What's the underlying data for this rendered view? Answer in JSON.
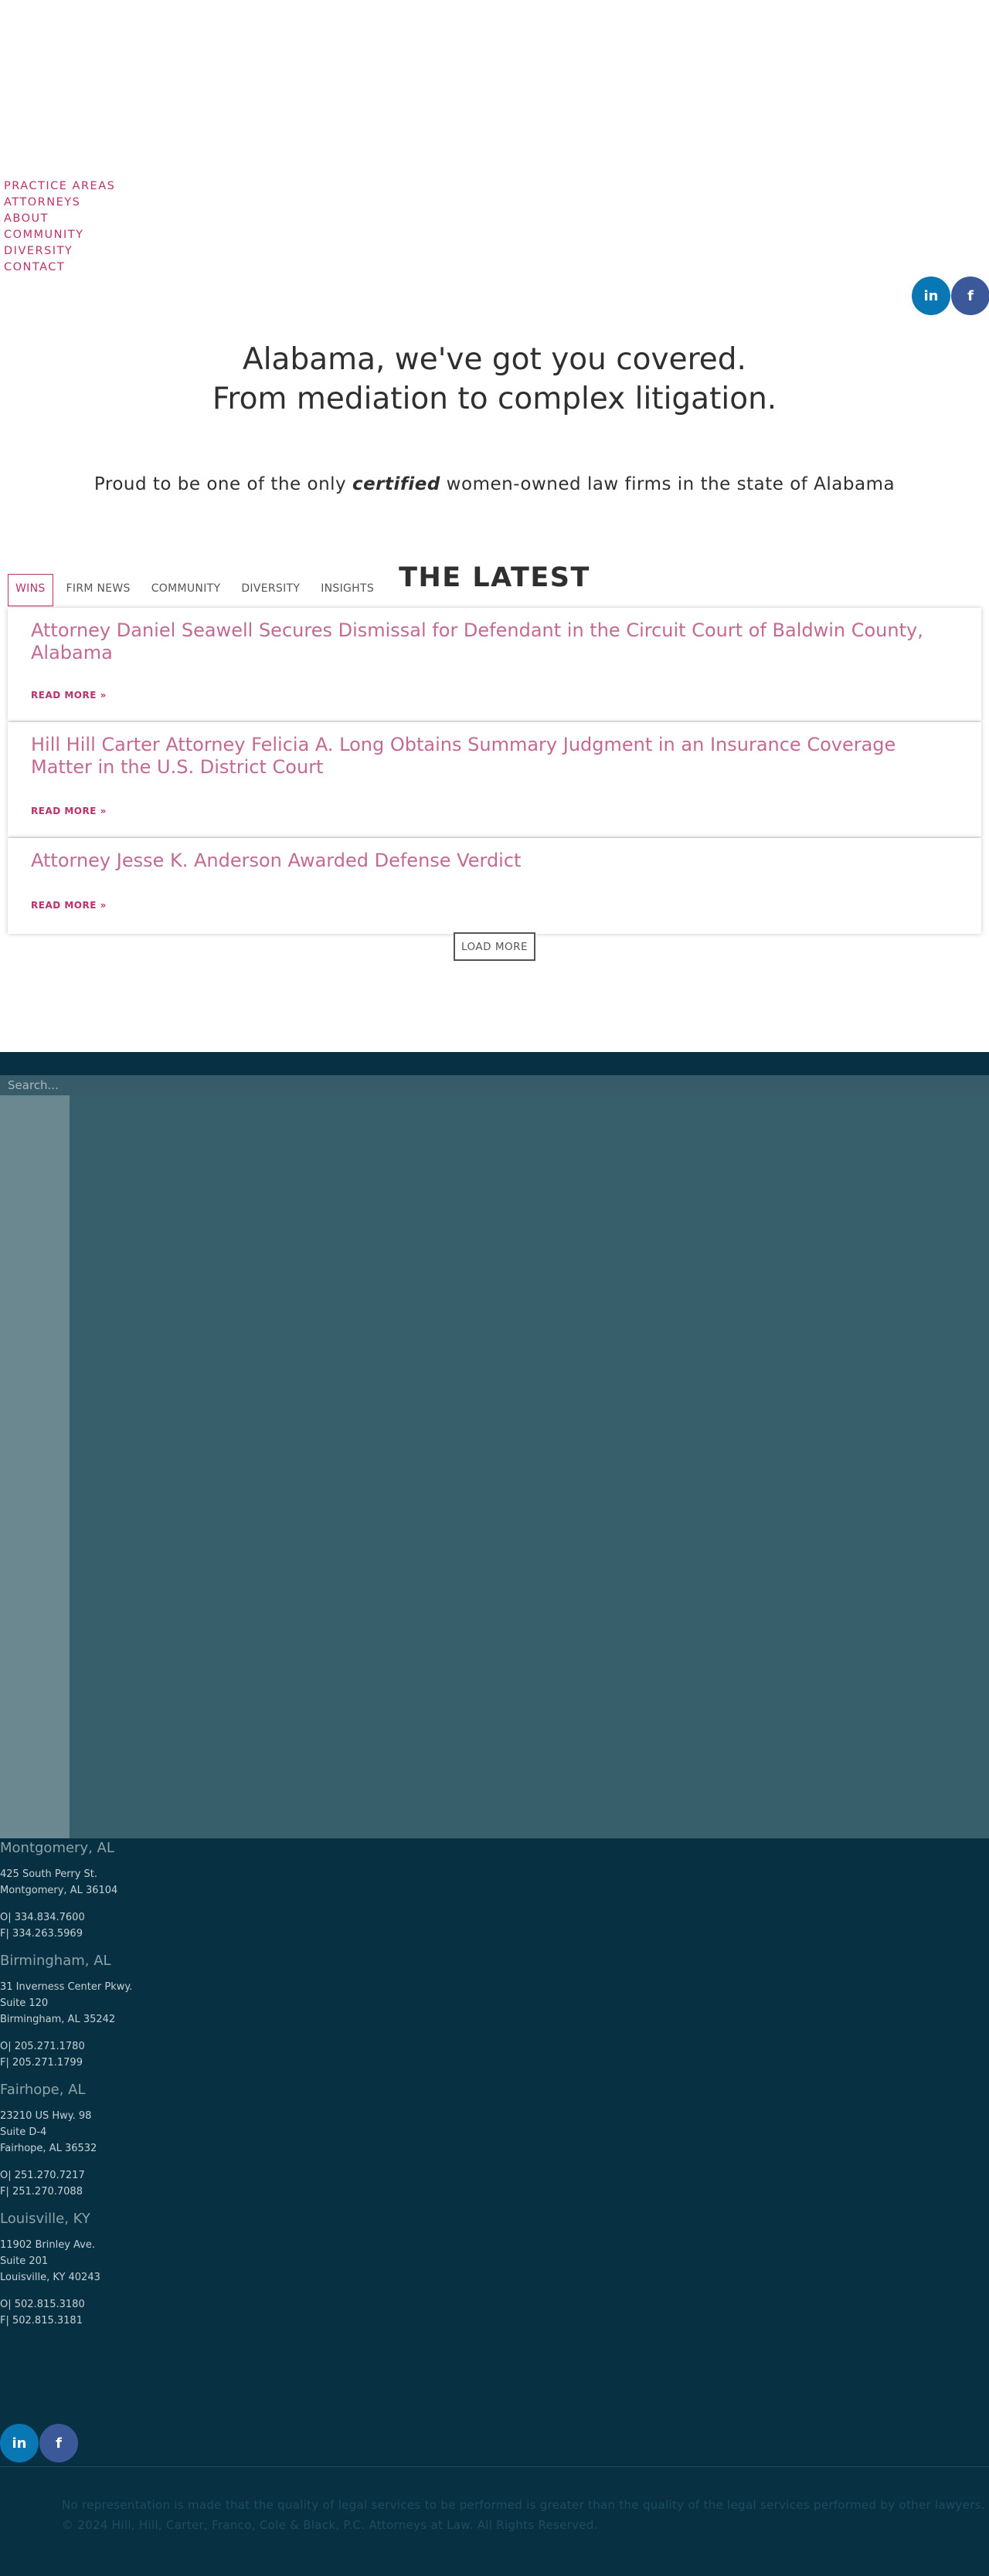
{
  "nav": {
    "items": [
      "PRACTICE AREAS",
      "ATTORNEYS",
      "ABOUT",
      "COMMUNITY",
      "DIVERSITY",
      "CONTACT"
    ]
  },
  "social": {
    "linkedin_label": "in",
    "facebook_label": "f",
    "linkedin_color": "#0a77b5",
    "facebook_color": "#3b5998"
  },
  "hero": {
    "line1": "Alabama, we've got you covered.",
    "line2": "From mediation to complex litigation."
  },
  "tagline": {
    "before": "Proud to be one of the only ",
    "emphasis": "certified",
    "after": " women-owned law firms in the state of Alabama"
  },
  "latest": {
    "title": "THE LATEST",
    "tabs": [
      "WINS",
      "FIRM NEWS",
      "COMMUNITY",
      "DIVERSITY",
      "INSIGHTS"
    ],
    "active_tab": "WINS",
    "posts": [
      {
        "title": "Attorney Daniel Seawell Secures Dismissal for Defendant in the Circuit Court of Baldwin County, Alabama",
        "read_more": "READ MORE »"
      },
      {
        "title": "Hill Hill Carter Attorney Felicia A. Long Obtains Summary Judgment in an Insurance Coverage Matter in the U.S. District Court",
        "read_more": "READ MORE »"
      },
      {
        "title": "Attorney Jesse K. Anderson Awarded Defense Verdict",
        "read_more": "READ MORE »"
      }
    ],
    "load_more": "LOAD MORE"
  },
  "footer": {
    "search_placeholder": "Search...",
    "offices": [
      {
        "city": "Montgomery, AL",
        "address": [
          "425 South Perry St.",
          "Montgomery, AL 36104"
        ],
        "phone": "O| 334.834.7600",
        "fax": "F| 334.263.5969"
      },
      {
        "city": "Birmingham, AL",
        "address": [
          "31 Inverness Center Pkwy.",
          "Suite 120",
          "Birmingham, AL 35242"
        ],
        "phone": "O| 205.271.1780",
        "fax": "F| 205.271.1799"
      },
      {
        "city": "Fairhope, AL",
        "address": [
          "23210 US Hwy. 98",
          "Suite D-4",
          "Fairhope, AL 36532"
        ],
        "phone": "O| 251.270.7217",
        "fax": "F| 251.270.7088"
      },
      {
        "city": "Louisville, KY",
        "address": [
          "11902 Brinley Ave.",
          "Suite 201",
          "Louisville, KY 40243"
        ],
        "phone": "O| 502.815.3180",
        "fax": "F| 502.815.3181"
      }
    ],
    "legal_line1": "No representation is made that the quality of legal services to be performed is greater than the quality of the legal services performed by other lawyers.",
    "legal_line2": "© 2024 Hill, Hill, Carter, Franco, Cole & Black, P.C. Attorneys at Law. All Rights Reserved."
  }
}
